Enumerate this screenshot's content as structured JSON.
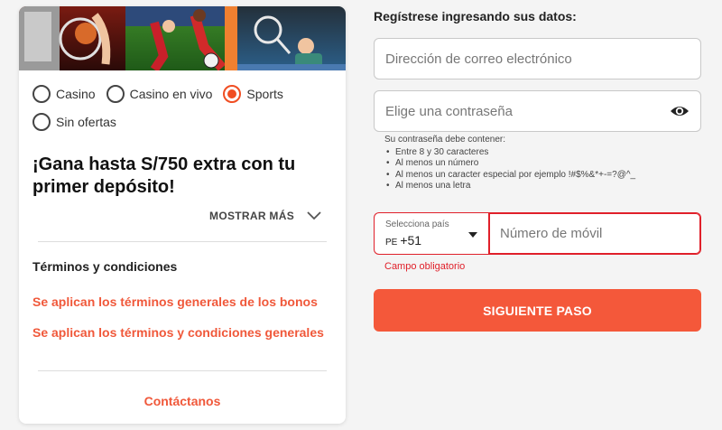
{
  "promo_card": {
    "offer_options": [
      {
        "label": "Casino",
        "checked": false
      },
      {
        "label": "Casino en vivo",
        "checked": false
      },
      {
        "label": "Sports",
        "checked": true
      },
      {
        "label": "Sin ofertas",
        "checked": false
      }
    ],
    "headline": "¡Gana hasta S/750 extra con tu primer depósito!",
    "show_more_label": "MOSTRAR MÁS",
    "show_more_icon": "chevron-down-icon",
    "terms_title": "Términos y condiciones",
    "links": [
      "Se aplican los términos generales de los bonos",
      "Se aplican los términos y condiciones generales"
    ],
    "contact_label": "Contáctanos"
  },
  "form": {
    "title": "Regístrese ingresando sus datos:",
    "email_placeholder": "Dirección de correo electrónico",
    "password_placeholder": "Elige una contraseña",
    "password_toggle_icon": "eye-icon",
    "password_hint_title": "Su contraseña debe contener:",
    "password_rules": [
      "Entre 8 y 30 caracteres",
      "Al menos un número",
      "Al menos un caracter especial por ejemplo !#$%&*+-=?@^_",
      "Al menos una letra"
    ],
    "country_label": "Selecciona país",
    "country_iso": "PE",
    "country_dial_code": "+51",
    "phone_placeholder": "Número de móvil",
    "phone_error": "Campo obligatorio",
    "submit_label": "SIGUIENTE PASO"
  },
  "colors": {
    "accent": "#f4583a",
    "error": "#e0202a",
    "background": "#f4f4f4"
  }
}
